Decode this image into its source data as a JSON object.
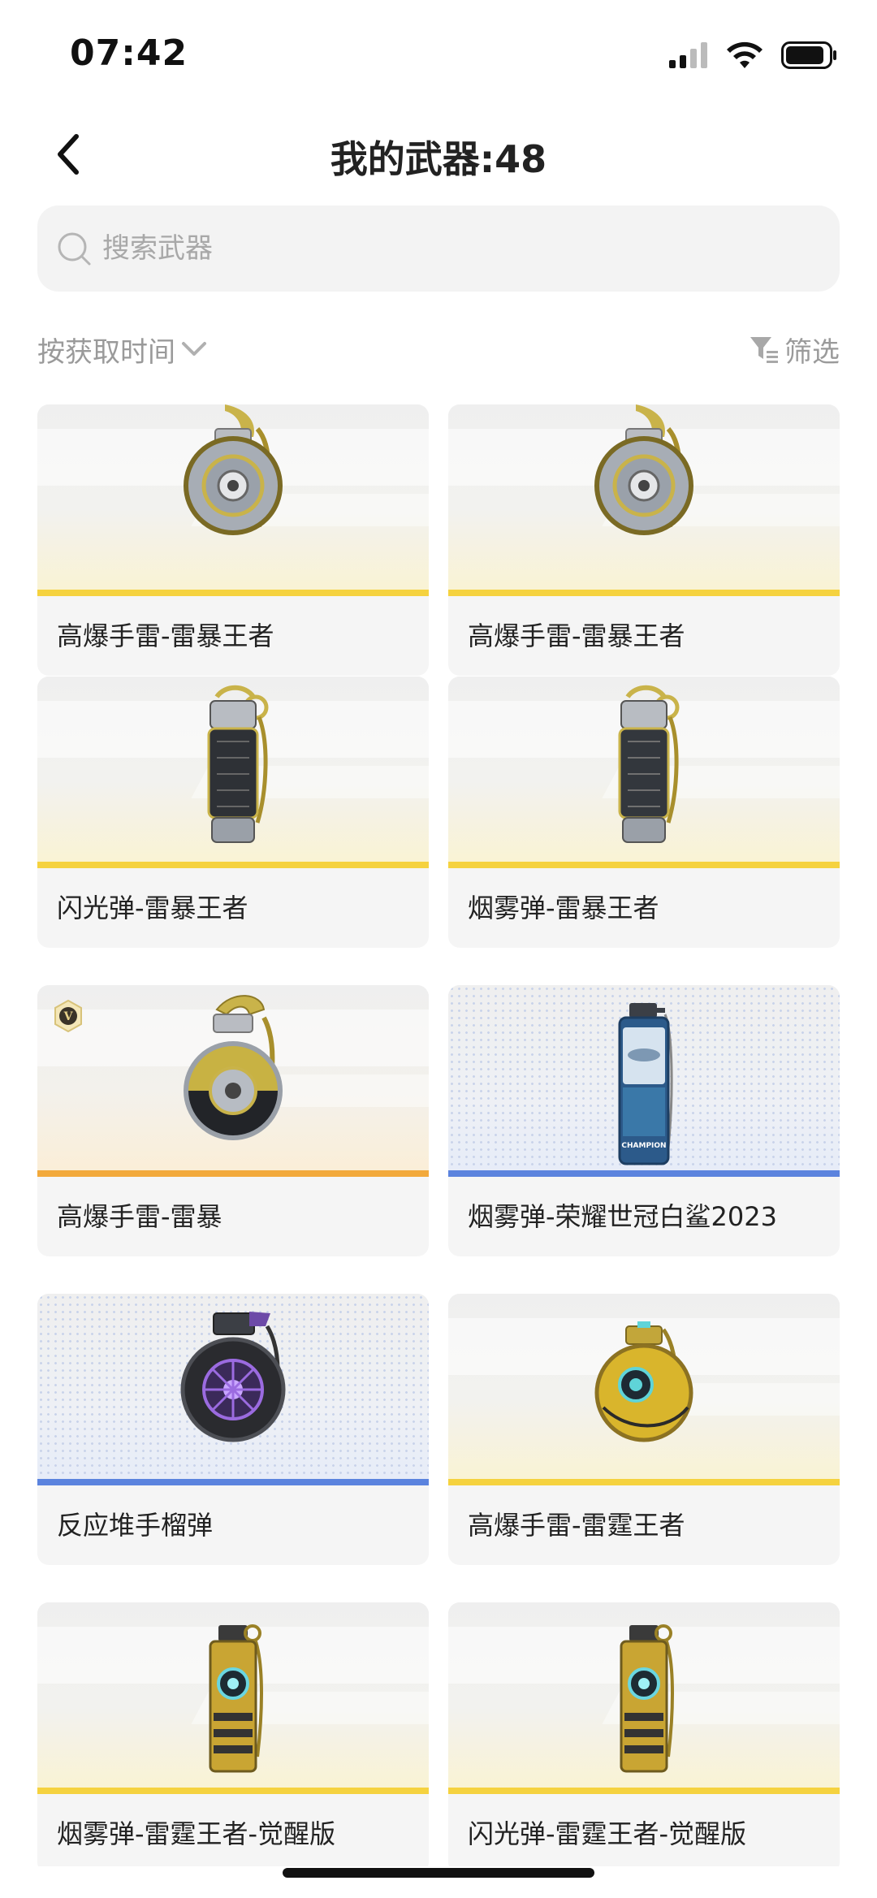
{
  "status_bar": {
    "time": "07:42"
  },
  "header": {
    "title": "我的武器:48"
  },
  "search": {
    "placeholder": "搜索武器"
  },
  "toolbar": {
    "sort_label": "按获取时间",
    "filter_label": "筛选"
  },
  "colors": {
    "gold": "#f5d23f",
    "orange": "#f2a93b",
    "blue": "#5b83de"
  },
  "weapons": [
    {
      "name": "高爆手雷-雷暴王者",
      "tier": "gold",
      "icon": "frag-grenade-storm-king-icon"
    },
    {
      "name": "高爆手雷-雷暴王者",
      "tier": "gold",
      "icon": "frag-grenade-storm-king-icon"
    },
    {
      "name": "闪光弹-雷暴王者",
      "tier": "gold",
      "icon": "flashbang-storm-king-icon"
    },
    {
      "name": "烟雾弹-雷暴王者",
      "tier": "gold",
      "icon": "smoke-grenade-storm-king-icon"
    },
    {
      "name": "高爆手雷-雷暴",
      "tier": "orange",
      "icon": "frag-grenade-storm-icon",
      "badge": "V"
    },
    {
      "name": "烟雾弹-荣耀世冠白鲨2023",
      "tier": "blue",
      "icon": "smoke-grenade-white-shark-icon",
      "can_text": "CHAMPION"
    },
    {
      "name": "反应堆手榴弹",
      "tier": "blue",
      "icon": "reactor-grenade-icon"
    },
    {
      "name": "高爆手雷-雷霆王者",
      "tier": "gold",
      "icon": "frag-grenade-thunder-king-icon"
    },
    {
      "name": "烟雾弹-雷霆王者-觉醒版",
      "tier": "gold",
      "icon": "smoke-grenade-thunder-king-awakened-icon"
    },
    {
      "name": "闪光弹-雷霆王者-觉醒版",
      "tier": "gold",
      "icon": "flashbang-thunder-king-awakened-icon"
    }
  ]
}
